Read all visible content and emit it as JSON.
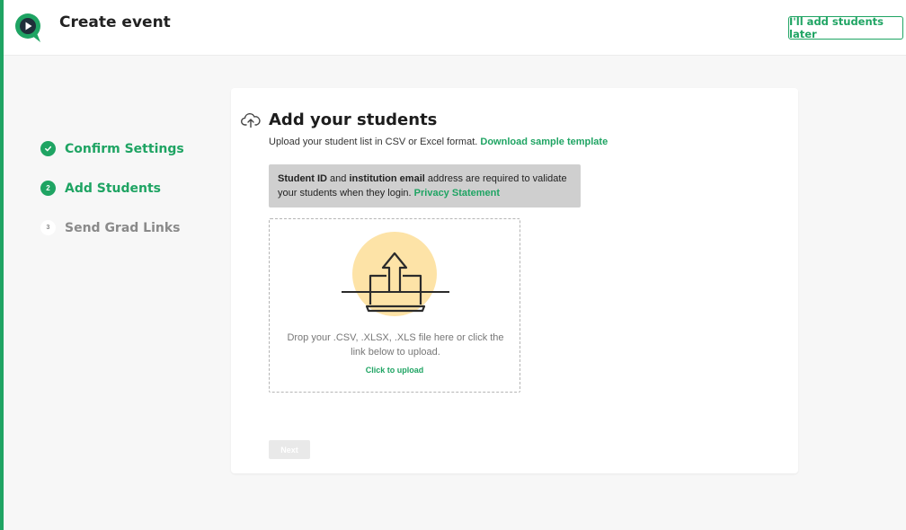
{
  "header": {
    "title": "Create event",
    "later_button": "I'll add students later"
  },
  "steps": [
    {
      "number": "",
      "label": "Confirm Settings",
      "status": "done"
    },
    {
      "number": "2",
      "label": "Add Students",
      "status": "active"
    },
    {
      "number": "3",
      "label": "Send Grad Links",
      "status": "pending"
    }
  ],
  "card": {
    "title": "Add your students",
    "subtitle": "Upload your student list in CSV or Excel format.",
    "template_link": "Download sample template",
    "notice": {
      "bold1": "Student ID",
      "text1": " and ",
      "bold2": "institution email",
      "text2": " address are required to validate your students when they login. ",
      "link": "Privacy Statement"
    },
    "dropzone": {
      "text": "Drop your .CSV, .XLSX, .XLS file here or click the link below to upload.",
      "link": "Click to upload"
    },
    "next_button": "Next"
  },
  "colors": {
    "accent": "#1fa463",
    "notice_bg": "#cfcfcf",
    "illustration_circle": "#fde3a7"
  }
}
